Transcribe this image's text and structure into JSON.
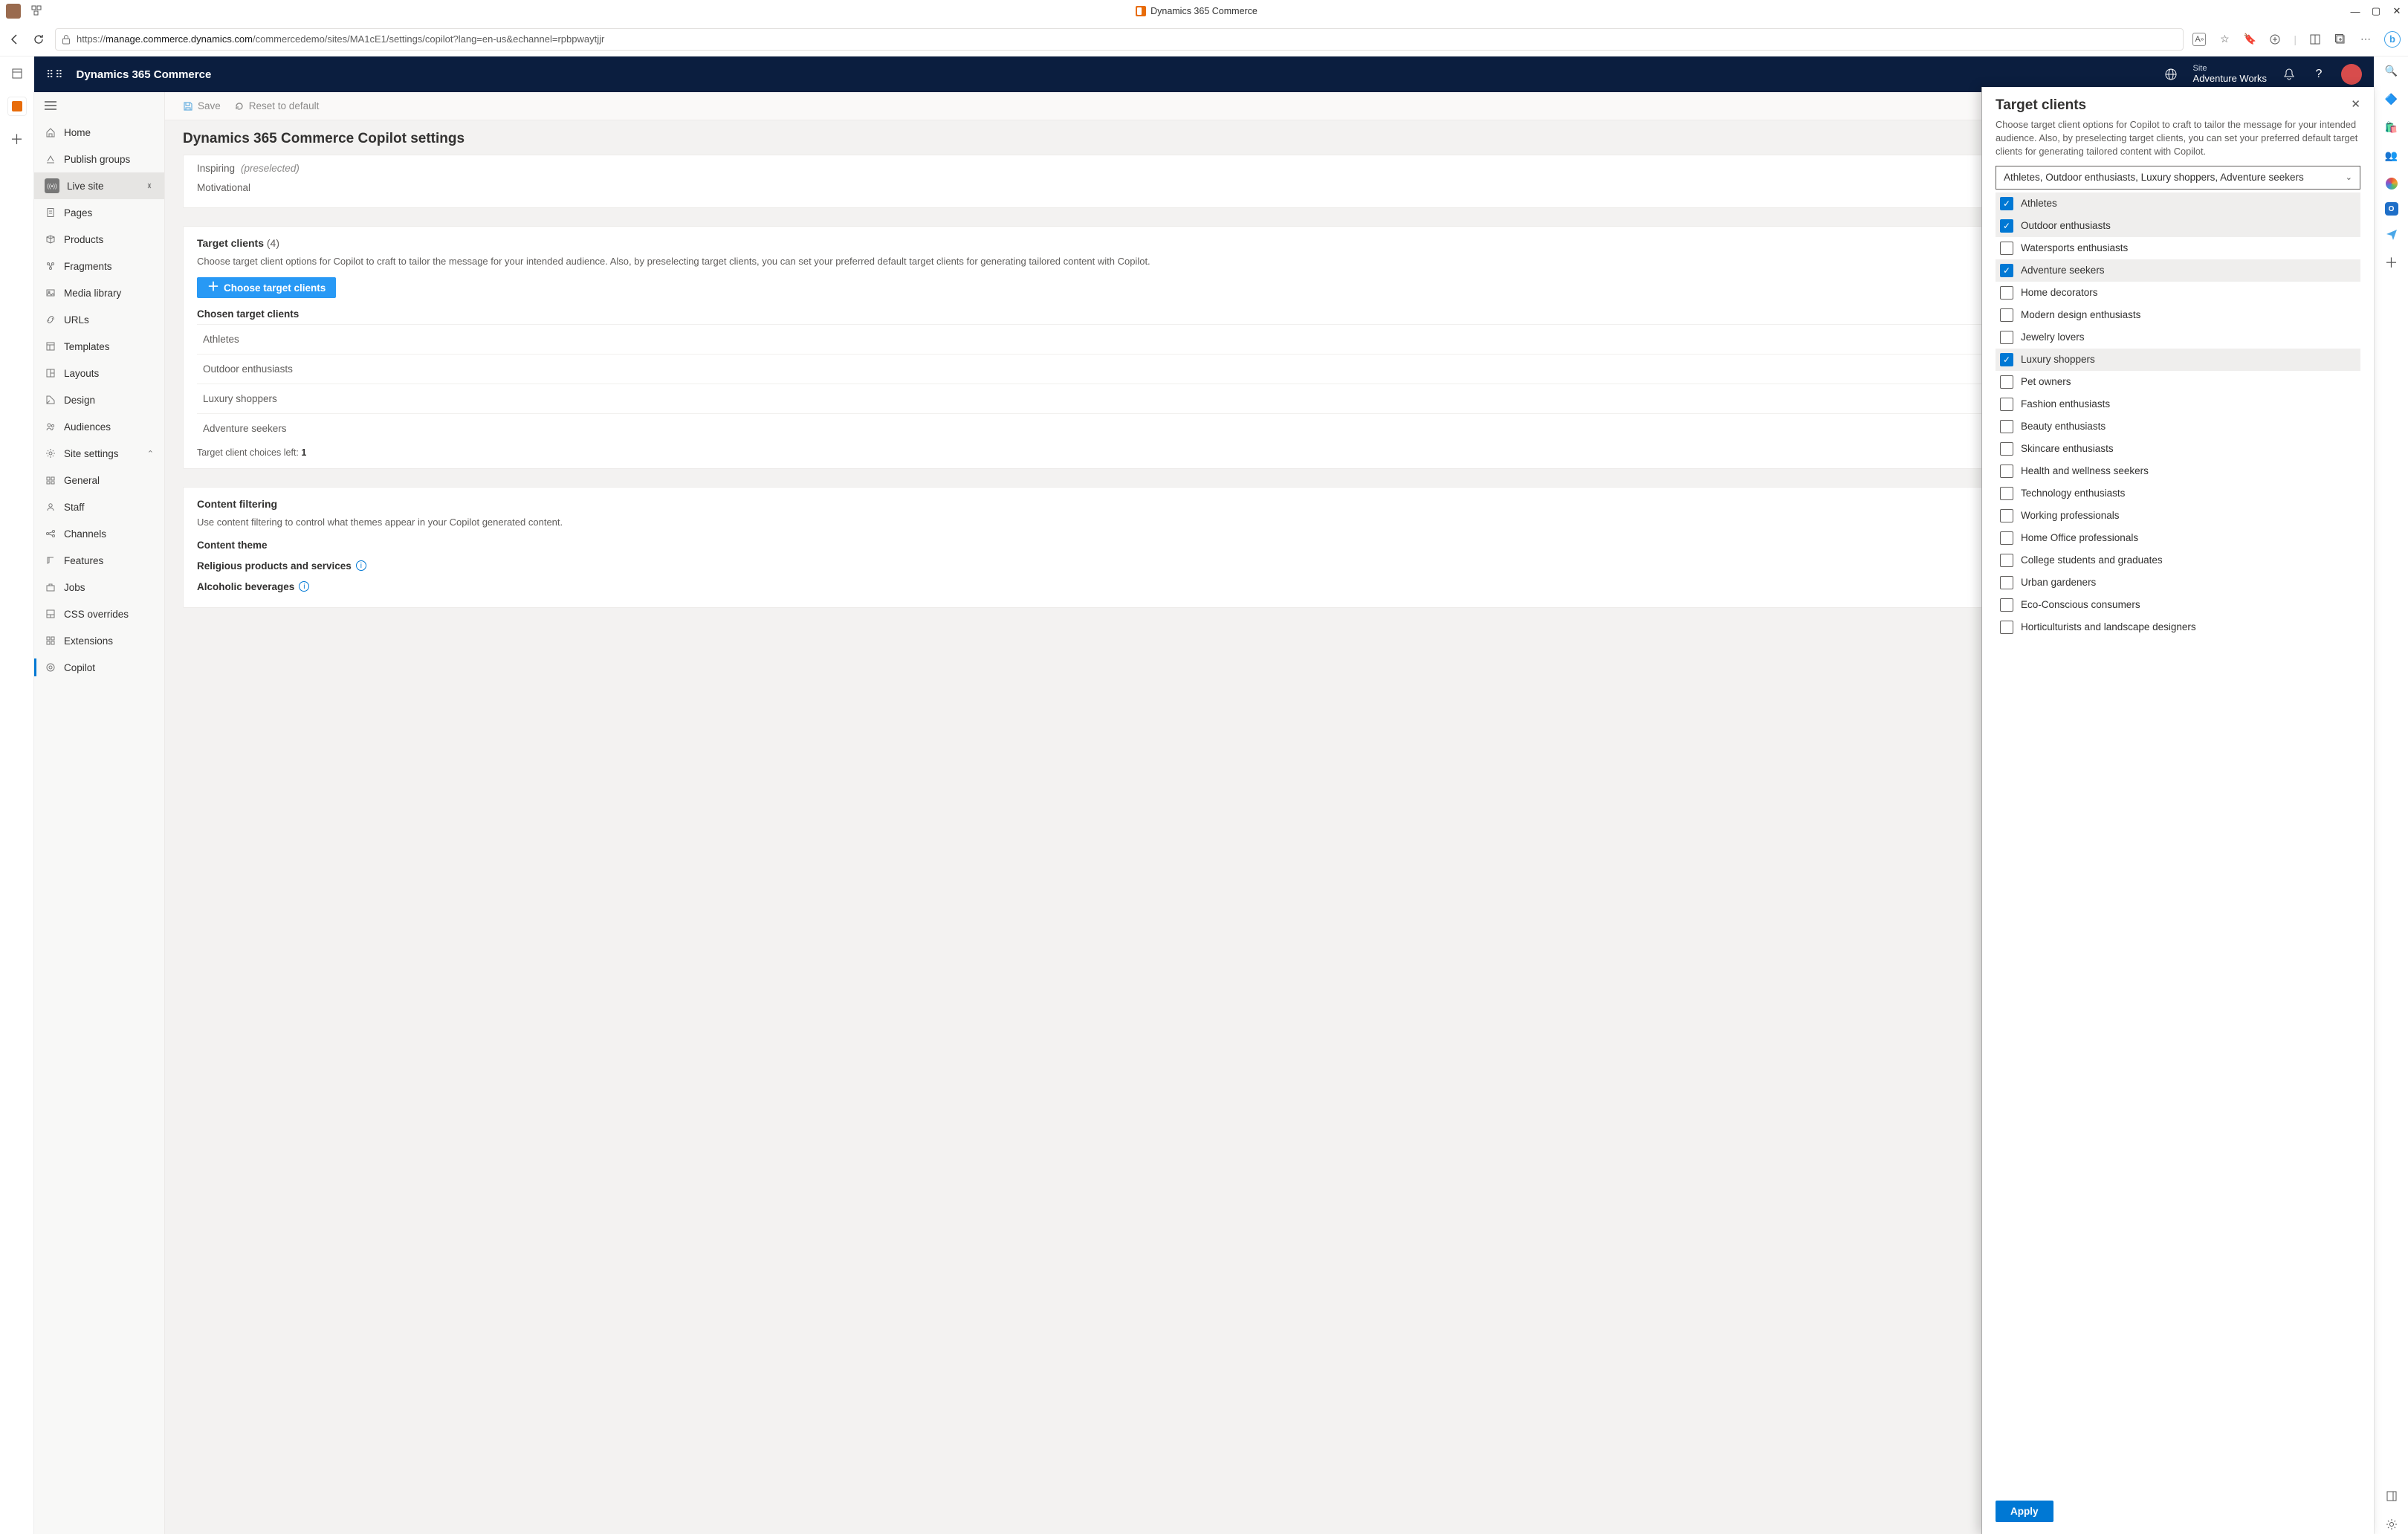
{
  "os": {
    "window_title": "Dynamics 365 Commerce",
    "min": "—",
    "max": "▢",
    "close": "✕"
  },
  "browser": {
    "url_domain": "manage.commerce.dynamics.com",
    "url_path": "/commercedemo/sites/MA1cE1/settings/copilot?lang=en-us&echannel=rpbpwaytjjr"
  },
  "appHeader": {
    "product": "Dynamics 365 Commerce",
    "siteLabel": "Site",
    "siteName": "Adventure Works"
  },
  "sidebar": {
    "items": [
      {
        "icon": "home",
        "label": "Home"
      },
      {
        "icon": "publish",
        "label": "Publish groups"
      },
      {
        "icon": "live",
        "label": "Live site",
        "live": true,
        "chev": true
      },
      {
        "icon": "pages",
        "label": "Pages"
      },
      {
        "icon": "products",
        "label": "Products"
      },
      {
        "icon": "fragments",
        "label": "Fragments"
      },
      {
        "icon": "media",
        "label": "Media library"
      },
      {
        "icon": "urls",
        "label": "URLs"
      },
      {
        "icon": "templates",
        "label": "Templates"
      },
      {
        "icon": "layouts",
        "label": "Layouts"
      },
      {
        "icon": "design",
        "label": "Design"
      },
      {
        "icon": "audiences",
        "label": "Audiences"
      },
      {
        "icon": "settings",
        "label": "Site settings",
        "chev": "up"
      },
      {
        "icon": "general",
        "label": "General"
      },
      {
        "icon": "staff",
        "label": "Staff"
      },
      {
        "icon": "channels",
        "label": "Channels"
      },
      {
        "icon": "features",
        "label": "Features"
      },
      {
        "icon": "jobs",
        "label": "Jobs"
      },
      {
        "icon": "css",
        "label": "CSS overrides"
      },
      {
        "icon": "ext",
        "label": "Extensions"
      },
      {
        "icon": "copilot",
        "label": "Copilot",
        "selected": true
      }
    ]
  },
  "cmdbar": {
    "save": "Save",
    "reset": "Reset to default"
  },
  "page": {
    "title": "Dynamics 365 Commerce Copilot settings",
    "tone_rows": [
      {
        "label": "Inspiring",
        "tag": "(preselected)"
      },
      {
        "label": "Motivational"
      }
    ],
    "target_heading": "Target clients",
    "target_count": "(4)",
    "target_desc": "Choose target client options for Copilot to craft to tailor the message for your intended audience. Also, by preselecting target clients, you can set your preferred default target clients for generating tailored content with Copilot.",
    "choose_btn": "Choose target clients",
    "chosen_heading": "Chosen target clients",
    "chosen": [
      "Athletes",
      "Outdoor enthusiasts",
      "Luxury shoppers",
      "Adventure seekers"
    ],
    "choices_left_label": "Target client choices left:",
    "choices_left_value": "1",
    "filter_heading": "Content filtering",
    "filter_desc": "Use content filtering to control what themes appear in your Copilot generated content.",
    "content_theme": "Content theme",
    "filters": [
      "Religious products and services",
      "Alcoholic beverages"
    ]
  },
  "flyout": {
    "title": "Target clients",
    "desc": "Choose target client options for Copilot to craft to tailor the message for your intended audience. Also, by preselecting target clients, you can set your preferred default target clients for generating tailored content with Copilot.",
    "combo_value": "Athletes, Outdoor enthusiasts, Luxury shoppers, Adventure seekers",
    "options": [
      {
        "label": "Athletes",
        "checked": true
      },
      {
        "label": "Outdoor enthusiasts",
        "checked": true
      },
      {
        "label": "Watersports enthusiasts",
        "checked": false
      },
      {
        "label": "Adventure seekers",
        "checked": true
      },
      {
        "label": "Home decorators",
        "checked": false
      },
      {
        "label": "Modern design enthusiasts",
        "checked": false
      },
      {
        "label": "Jewelry lovers",
        "checked": false
      },
      {
        "label": "Luxury shoppers",
        "checked": true
      },
      {
        "label": "Pet owners",
        "checked": false
      },
      {
        "label": "Fashion enthusiasts",
        "checked": false
      },
      {
        "label": "Beauty enthusiasts",
        "checked": false
      },
      {
        "label": "Skincare enthusiasts",
        "checked": false
      },
      {
        "label": "Health and wellness seekers",
        "checked": false
      },
      {
        "label": "Technology enthusiasts",
        "checked": false
      },
      {
        "label": "Working professionals",
        "checked": false
      },
      {
        "label": "Home Office professionals",
        "checked": false
      },
      {
        "label": "College students and graduates",
        "checked": false
      },
      {
        "label": "Urban gardeners",
        "checked": false
      },
      {
        "label": "Eco-Conscious consumers",
        "checked": false
      },
      {
        "label": "Horticulturists and landscape designers",
        "checked": false
      }
    ],
    "apply": "Apply"
  }
}
